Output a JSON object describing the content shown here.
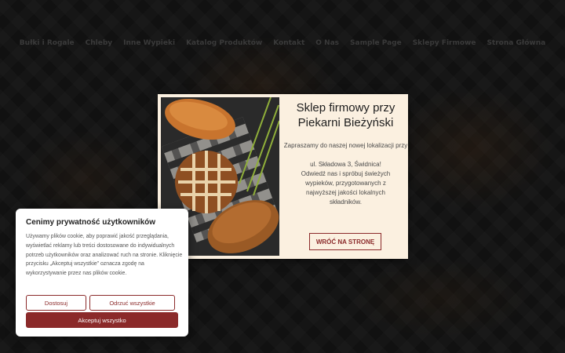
{
  "nav": {
    "items": [
      "Bułki i Rogale",
      "Chleby",
      "Inne Wypieki",
      "Katalog Produktów",
      "Kontakt",
      "O Nas",
      "Sample Page",
      "Sklepy Firmowe",
      "Strona Główna"
    ]
  },
  "modal": {
    "title": "Sklep firmowy przy Piekarni Bieżyński",
    "intro": "Zapraszamy do naszej nowej lokalizacji przy",
    "address": "ul. Składowa 3, Świdnica!",
    "body": "Odwiedź nas i spróbuj świeżych wypieków, przygotowanych z najwyższej jakości lokalnych składników.",
    "back_label": "WRÓĆ NA STRONĘ"
  },
  "cookie": {
    "title": "Cenimy prywatność użytkowników",
    "text": "Używamy plików cookie, aby poprawić jakość przeglądania, wyświetlać reklamy lub treści dostosowane do indywidualnych potrzeb użytkowników oraz analizować ruch na stronie. Kliknięcie przycisku „Akceptuj wszystkie” oznacza zgodę na wykorzystywanie przez nas plików cookie.",
    "customize_label": "Dostosuj",
    "reject_label": "Odrzuć wszystkie",
    "accept_label": "Akceptuj wszystko"
  },
  "colors": {
    "accent": "#8b2a2a",
    "modal_bg": "#fbf0e0"
  }
}
